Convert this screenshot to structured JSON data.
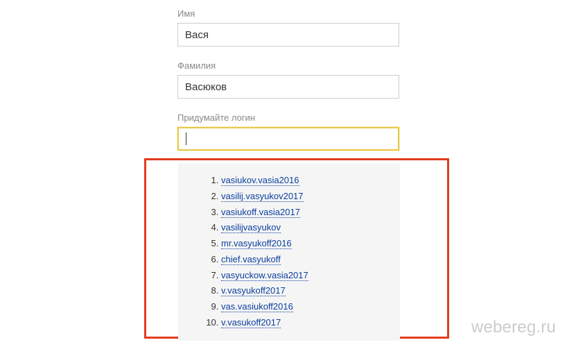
{
  "form": {
    "first_name": {
      "label": "Имя",
      "value": "Вася"
    },
    "last_name": {
      "label": "Фамилия",
      "value": "Васюков"
    },
    "login": {
      "label": "Придумайте логин",
      "value": ""
    }
  },
  "suggestions": [
    "vasiukov.vasia2016",
    "vasilij.vasyukov2017",
    "vasiukoff.vasia2017",
    "vasilijvasyukov",
    "mr.vasyukoff2016",
    "chief.vasyukoff",
    "vasyuckow.vasia2017",
    "v.vasyukoff2017",
    "vas.vasiukoff2016",
    "v.vasukoff2017"
  ],
  "watermark": "webereg.ru"
}
